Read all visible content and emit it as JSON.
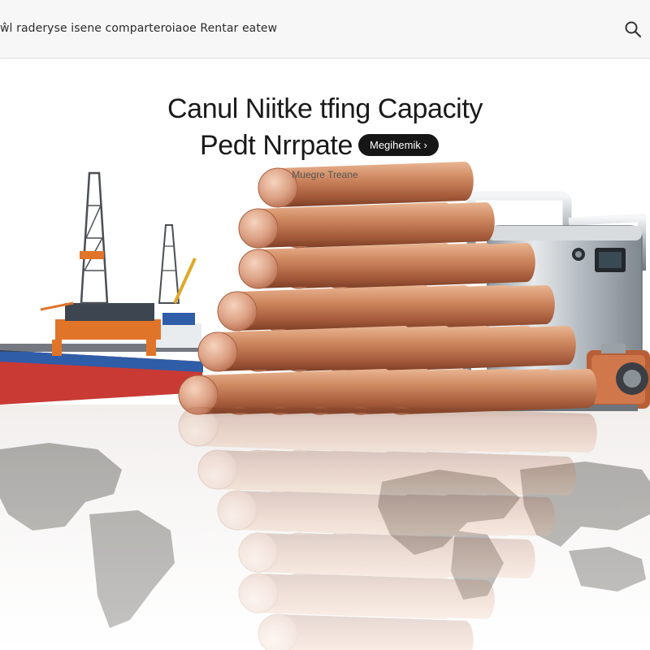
{
  "header": {
    "nav_text": "ŵl raderyse isene comparteroiaoe  Rentar eatew",
    "search_icon": "search-icon"
  },
  "hero": {
    "title_line1": "Canul Niitke tfing Capacity",
    "title_line2": "Pedt Nrrpate",
    "cta_label": "Megihemik ›",
    "subtitle": "Muegre Treane"
  },
  "colors": {
    "copper": "#c9835e",
    "copper_dark": "#a1593a",
    "steel": "#c7ccd0",
    "ship_red": "#c93a35",
    "ship_blue": "#2f5da8",
    "rig_orange": "#e0752a",
    "cta_bg": "#161616"
  },
  "scene": {
    "left_image": "offshore-oil-rig-and-tanker",
    "center_image": "stacked-copper-nickel-rods",
    "right_image": "stainless-steel-processing-unit",
    "floor_image": "reflective-world-map-floor"
  }
}
